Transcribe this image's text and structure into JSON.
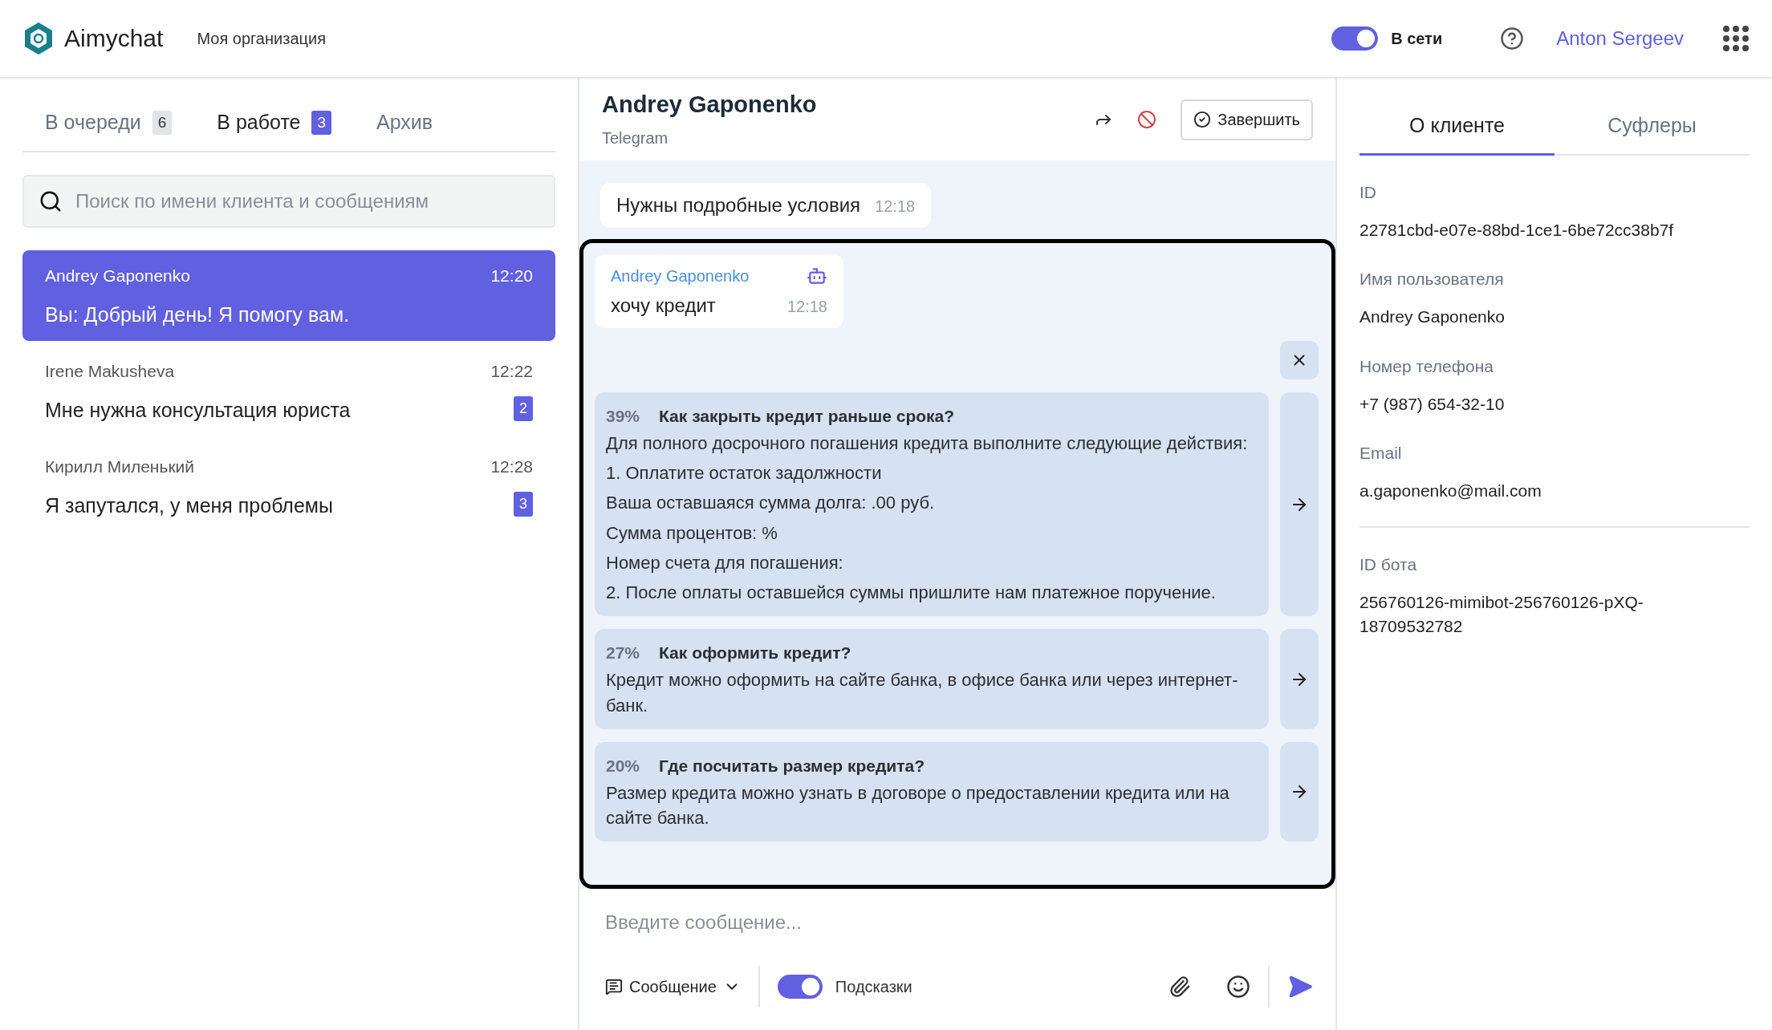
{
  "header": {
    "logo": "Aimychat",
    "organization": "Моя организация",
    "status": {
      "label": "В сети",
      "on": true
    },
    "user": "Anton Sergeev"
  },
  "chat_list": {
    "tabs": [
      {
        "label": "В очереди",
        "count": "6",
        "selected": false
      },
      {
        "label": "В работе",
        "count": "3",
        "selected": true
      },
      {
        "label": "Архив",
        "selected": false
      }
    ],
    "search": {
      "placeholder": "Поиск по имени клиента и сообщениям"
    },
    "chats": [
      {
        "name": "Andrey Gaponenko",
        "time": "12:20",
        "message": "Вы: Добрый день! Я помогу вам.",
        "selected": true
      },
      {
        "name": "Irene Makusheva",
        "time": "12:22",
        "message": "Мне нужна консультация юриста",
        "unread": "2",
        "selected": false
      },
      {
        "name": "Кирилл Миленький",
        "time": "12:28",
        "message": "Я запутался, у меня проблемы",
        "unread": "3",
        "selected": false
      }
    ]
  },
  "conversation": {
    "name": "Andrey Gaponenko",
    "channel": "Telegram",
    "finish_button": "Завершить",
    "messages": [
      {
        "kind": "plain",
        "text": "Нужны подробные условия",
        "time": "12:18"
      },
      {
        "kind": "bot",
        "sender": "Andrey Gaponenko",
        "text": "хочу кредит",
        "time": "12:18"
      }
    ],
    "suggestions": [
      {
        "score": "39%",
        "question": "Как закрыть кредит раньше срока?",
        "lines": [
          "Для полного досрочного погашения кредита выполните следующие действия:",
          "1. Оплатите остаток задолжности",
          "Ваша оставшаяся сумма долга: .00 руб.",
          "Сумма процентов: %",
          "Номер счета для погашения:",
          "2. После оплаты оставшейся суммы пришлите нам платежное поручение."
        ]
      },
      {
        "score": "27%",
        "question": "Как оформить кредит?",
        "lines": [
          "Кредит можно оформить на сайте банка, в офисе банка или через интернет-банк."
        ]
      },
      {
        "score": "20%",
        "question": "Где посчитать размер кредита?",
        "lines": [
          "Размер кредита можно узнать в договоре о предоставлении кредита или на сайте банка."
        ]
      }
    ],
    "composer": {
      "placeholder": "Введите сообщение...",
      "mode": "Сообщение",
      "hints": {
        "label": "Подсказки",
        "on": true
      }
    }
  },
  "client_panel": {
    "tabs": [
      {
        "label": "О клиенте",
        "selected": true
      },
      {
        "label": "Суфлеры",
        "selected": false
      }
    ],
    "fields": [
      {
        "label": "ID",
        "value": "22781cbd-e07e-88bd-1ce1-6be72cc38b7f"
      },
      {
        "label": "Имя пользователя",
        "value": "Andrey Gaponenko"
      },
      {
        "label": "Номер телефона",
        "value": "+7 (987) 654-32-10"
      },
      {
        "label": "Email",
        "value": "a.gaponenko@mail.com"
      }
    ],
    "bot_fields": [
      {
        "label": "ID бота",
        "value": "256760126-mimibot-256760126-pXQ-18709532782"
      }
    ]
  }
}
